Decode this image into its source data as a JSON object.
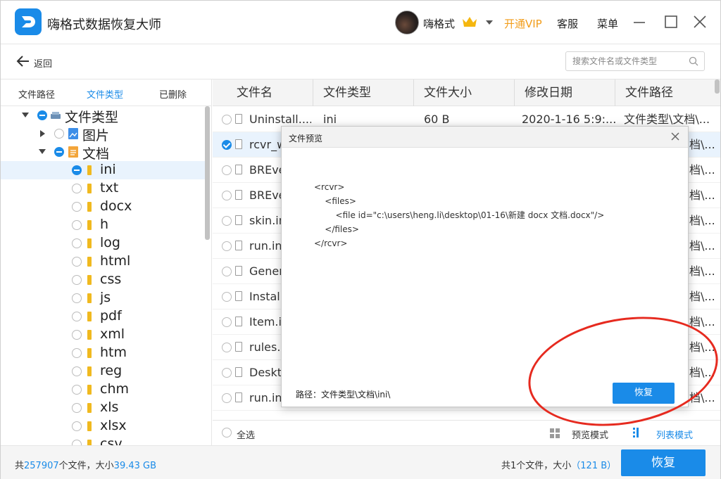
{
  "app": {
    "title": "嗨格式数据恢复大师",
    "username": "嗨格式",
    "vip_label": "开通VIP",
    "service_label": "客服",
    "menu_label": "菜单",
    "brand_color": "#1a8be8",
    "vip_color": "#f29d1a"
  },
  "toolbar": {
    "back_label": "返回",
    "search_placeholder": "搜索文件名或文件类型"
  },
  "sidebar": {
    "tabs": [
      {
        "label": "文件路径",
        "active": false
      },
      {
        "label": "文件类型",
        "active": true
      },
      {
        "label": "已删除",
        "active": false
      }
    ],
    "tree": {
      "root": "文件类型",
      "pictures": "图片",
      "documents": "文档",
      "types": [
        "ini",
        "txt",
        "docx",
        "h",
        "log",
        "html",
        "css",
        "js",
        "pdf",
        "xml",
        "htm",
        "reg",
        "chm",
        "xls",
        "xlsx",
        "csv"
      ]
    }
  },
  "table": {
    "columns": [
      "文件名",
      "文件类型",
      "文件大小",
      "修改日期",
      "文件路径"
    ],
    "rows": [
      {
        "name": "Uninstall....",
        "type": "ini",
        "size": "60 B",
        "date": "2020-1-16 5:9:...",
        "path": "文件类型\\文档\\...",
        "checked": false
      },
      {
        "name": "rcvr_w",
        "type": "",
        "size": "",
        "date": "",
        "path": "档\\...",
        "checked": true
      },
      {
        "name": "BREve",
        "type": "",
        "size": "",
        "date": "",
        "path": "档\\...",
        "checked": false
      },
      {
        "name": "BREve",
        "type": "",
        "size": "",
        "date": "",
        "path": "档\\...",
        "checked": false
      },
      {
        "name": "skin.in",
        "type": "",
        "size": "",
        "date": "",
        "path": "档\\...",
        "checked": false
      },
      {
        "name": "run.in",
        "type": "",
        "size": "",
        "date": "",
        "path": "档\\...",
        "checked": false
      },
      {
        "name": "Gener",
        "type": "",
        "size": "",
        "date": "",
        "path": "档\\...",
        "checked": false
      },
      {
        "name": "Install",
        "type": "",
        "size": "",
        "date": "",
        "path": "档\\...",
        "checked": false
      },
      {
        "name": "Item.i",
        "type": "",
        "size": "",
        "date": "",
        "path": "档\\...",
        "checked": false
      },
      {
        "name": "rules.i",
        "type": "",
        "size": "",
        "date": "",
        "path": "档\\...",
        "checked": false
      },
      {
        "name": "Deskt",
        "type": "",
        "size": "",
        "date": "",
        "path": "档\\...",
        "checked": false
      },
      {
        "name": "run.in",
        "type": "",
        "size": "",
        "date": "",
        "path": "档\\...",
        "checked": false
      }
    ],
    "select_all_label": "全选",
    "preview_mode_label": "预览模式",
    "list_mode_label": "列表模式"
  },
  "status": {
    "total_prefix": "共",
    "total_count": "257907",
    "total_mid": "个文件，大小",
    "total_size": "39.43 GB",
    "selected_prefix": "共1个文件，大小",
    "selected_size": "（121 B）",
    "recover_label": "恢复"
  },
  "dialog": {
    "title": "文件预览",
    "content_lines": [
      "<rcvr>",
      "    <files>",
      "        <file id=\"c:\\users\\heng.li\\desktop\\01-16\\新建 docx 文档.docx\"/>",
      "    </files>",
      "</rcvr>"
    ],
    "path_label": "路径：文件类型\\文档\\ini\\",
    "recover_label": "恢复"
  }
}
